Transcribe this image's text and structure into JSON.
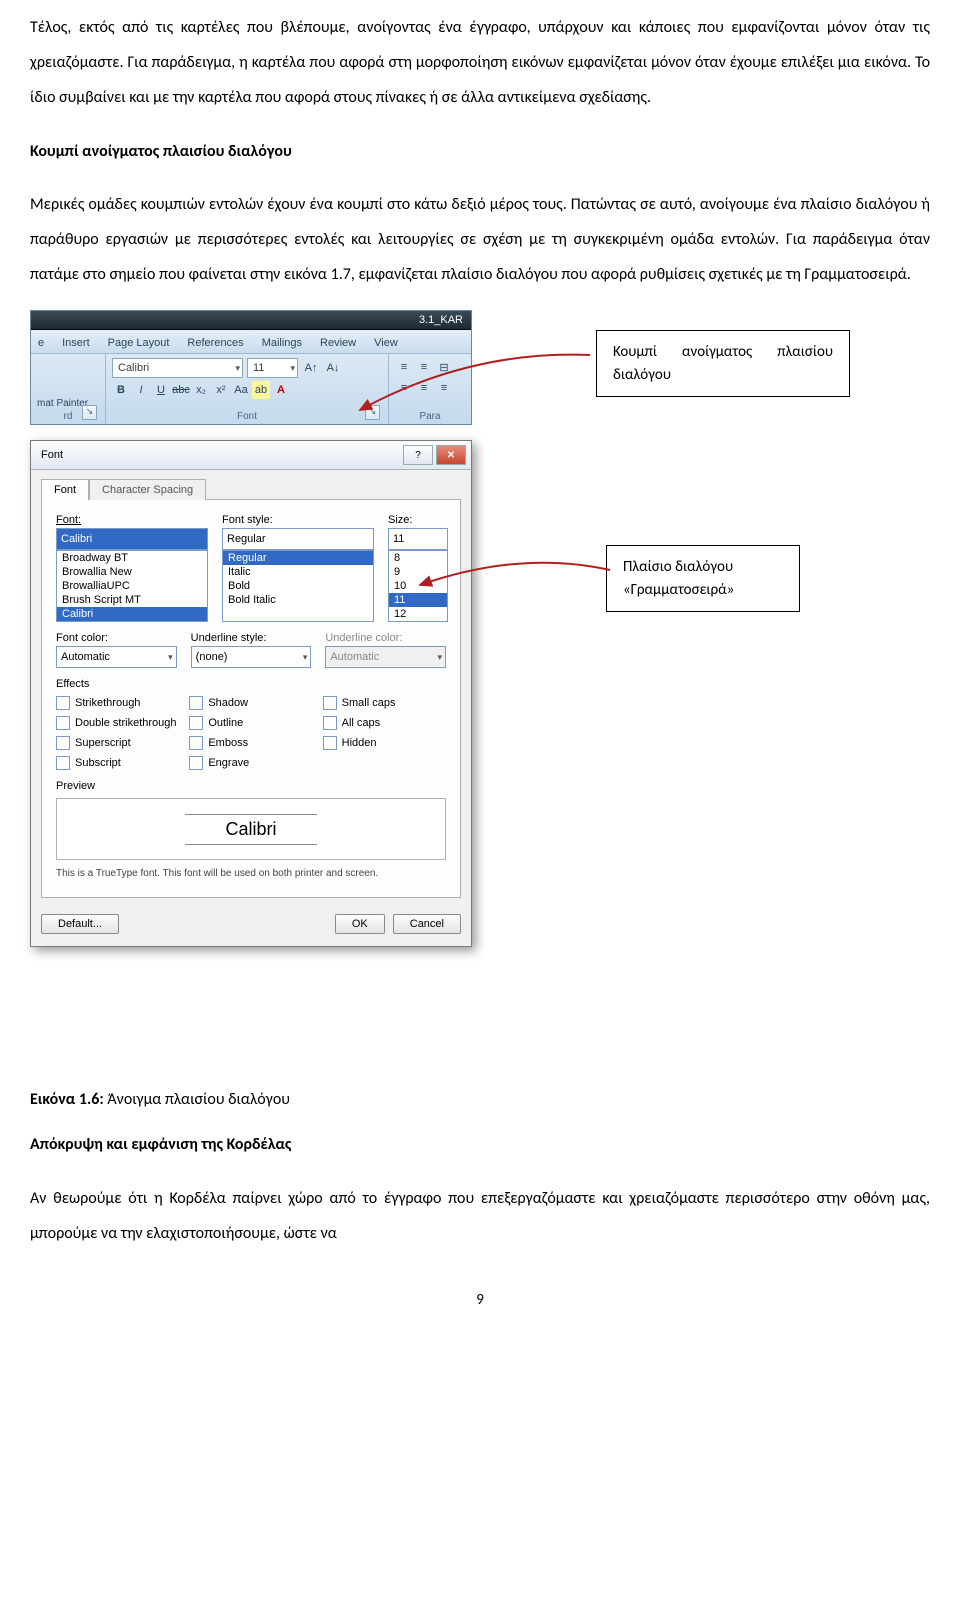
{
  "para1": "Τέλος, εκτός από τις καρτέλες που βλέπουμε, ανοίγοντας ένα έγγραφο, υπάρχουν και κάποιες που εμφανίζονται μόνον όταν τις χρειαζόμαστε. Για παράδειγμα, η καρτέλα που αφορά στη μορφοποίηση εικόνων εμφανίζεται μόνον όταν έχουμε επιλέξει μια εικόνα. Το ίδιο συμβαίνει και με την καρτέλα που αφορά στους πίνακες ή σε άλλα αντικείμενα σχεδίασης.",
  "heading1": "Κουμπί ανοίγματος πλαισίου διαλόγου",
  "para2": "Μερικές ομάδες κουμπιών εντολών έχουν ένα κουμπί στο κάτω δεξιό μέρος τους. Πατώντας σε αυτό, ανοίγουμε ένα πλαίσιο διαλόγου ή παράθυρο εργασιών με περισσότερες εντολές και λειτουργίες σε σχέση με τη συγκεκριμένη ομάδα εντολών. Για παράδειγμα όταν πατάμε στο σημείο που φαίνεται στην εικόνα 1.7, εμφανίζεται πλαίσιο διαλόγου που αφορά ρυθμίσεις σχετικές με τη Γραμματοσειρά.",
  "callout1": "Κουμπί ανοίγματος πλαισίου διαλόγου",
  "callout2_l1": "Πλαίσιο διαλόγου",
  "callout2_l2": "«Γραμματοσειρά»",
  "ribbon": {
    "doc_title": "3.1_KAR",
    "tabs": [
      "e",
      "Insert",
      "Page Layout",
      "References",
      "Mailings",
      "Review",
      "View"
    ],
    "clipboard_label": "mat Painter",
    "bottom_left": "rd",
    "font_name": "Calibri",
    "font_size": "11",
    "font_group": "Font",
    "para_group": "Para"
  },
  "dialog": {
    "title": "Font",
    "tab_font": "Font",
    "tab_spacing": "Character Spacing",
    "lbl_font": "Font:",
    "lbl_style": "Font style:",
    "lbl_size": "Size:",
    "font_value": "Calibri",
    "style_value": "Regular",
    "size_value": "11",
    "fonts": [
      "Broadway BT",
      "Browallia New",
      "BrowalliaUPC",
      "Brush Script MT",
      "Calibri"
    ],
    "styles": [
      "Regular",
      "Italic",
      "Bold",
      "Bold Italic"
    ],
    "sizes": [
      "8",
      "9",
      "10",
      "11",
      "12"
    ],
    "lbl_color": "Font color:",
    "lbl_ustyle": "Underline style:",
    "lbl_ucolor": "Underline color:",
    "color_val": "Automatic",
    "ustyle_val": "(none)",
    "ucolor_val": "Automatic",
    "effects_label": "Effects",
    "effects": [
      [
        "Strikethrough",
        "Shadow",
        "Small caps"
      ],
      [
        "Double strikethrough",
        "Outline",
        "All caps"
      ],
      [
        "Superscript",
        "Emboss",
        "Hidden"
      ],
      [
        "Subscript",
        "Engrave",
        ""
      ]
    ],
    "preview_label": "Preview",
    "preview_text": "Calibri",
    "preview_note": "This is a TrueType font. This font will be used on both printer and screen.",
    "btn_default": "Default...",
    "btn_ok": "OK",
    "btn_cancel": "Cancel"
  },
  "caption_bold": "Εικόνα 1.6:",
  "caption_rest": " Άνοιγμα πλαισίου διαλόγου",
  "heading2": "Απόκρυψη και εμφάνιση της Κορδέλας",
  "para3": "Αν θεωρούμε ότι η Κορδέλα παίρνει χώρο από το έγγραφο που επεξεργαζόμαστε και χρειαζόμαστε περισσότερο στην οθόνη μας, μπορούμε να την ελαχιστοποιήσουμε, ώστε να",
  "page_number": "9"
}
